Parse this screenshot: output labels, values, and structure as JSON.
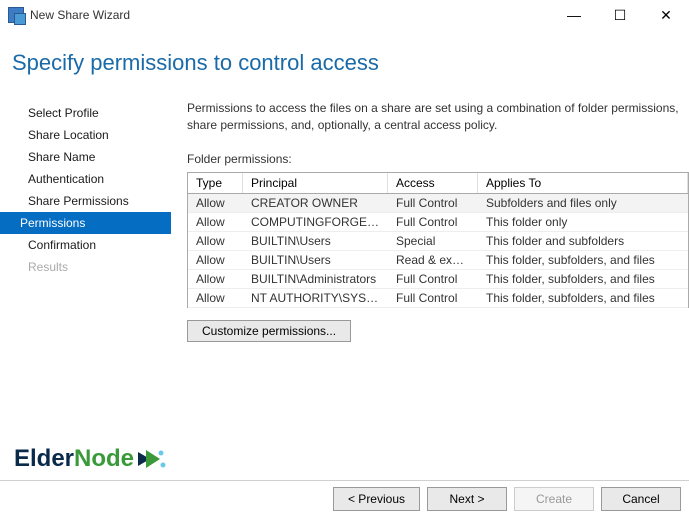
{
  "window": {
    "title": "New Share Wizard"
  },
  "header": {
    "title": "Specify permissions to control access"
  },
  "sidebar": {
    "items": [
      {
        "label": "Select Profile",
        "state": "normal"
      },
      {
        "label": "Share Location",
        "state": "normal"
      },
      {
        "label": "Share Name",
        "state": "normal"
      },
      {
        "label": "Authentication",
        "state": "normal"
      },
      {
        "label": "Share Permissions",
        "state": "normal"
      },
      {
        "label": "Permissions",
        "state": "active"
      },
      {
        "label": "Confirmation",
        "state": "normal"
      },
      {
        "label": "Results",
        "state": "disabled"
      }
    ]
  },
  "content": {
    "description": "Permissions to access the files on a share are set using a combination of folder permissions, share permissions, and, optionally, a central access policy.",
    "section_label": "Folder permissions:",
    "table": {
      "headers": {
        "type": "Type",
        "principal": "Principal",
        "access": "Access",
        "applies": "Applies To"
      },
      "rows": [
        {
          "type": "Allow",
          "principal": "CREATOR OWNER",
          "access": "Full Control",
          "applies": "Subfolders and files only"
        },
        {
          "type": "Allow",
          "principal": "COMPUTINGFORGEE\\te...",
          "access": "Full Control",
          "applies": "This folder only"
        },
        {
          "type": "Allow",
          "principal": "BUILTIN\\Users",
          "access": "Special",
          "applies": "This folder and subfolders"
        },
        {
          "type": "Allow",
          "principal": "BUILTIN\\Users",
          "access": "Read & execute",
          "applies": "This folder, subfolders, and files"
        },
        {
          "type": "Allow",
          "principal": "BUILTIN\\Administrators",
          "access": "Full Control",
          "applies": "This folder, subfolders, and files"
        },
        {
          "type": "Allow",
          "principal": "NT AUTHORITY\\SYSTEM",
          "access": "Full Control",
          "applies": "This folder, subfolders, and files"
        }
      ]
    },
    "customize_btn": "Customize permissions..."
  },
  "footer": {
    "previous": "< Previous",
    "next": "Next >",
    "create": "Create",
    "cancel": "Cancel"
  },
  "logo": {
    "part1": "Elder",
    "part2": "Node",
    "colors": {
      "elder": "#0a2a4a",
      "node": "#3a9a3a"
    }
  }
}
